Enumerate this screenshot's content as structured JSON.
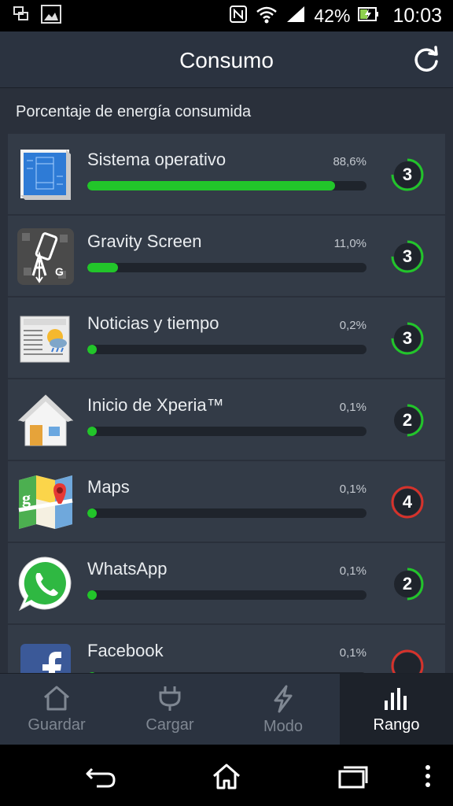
{
  "status_bar": {
    "left_icons": [
      "screenshot-icon",
      "image-icon"
    ],
    "right_icons": [
      "nfc-icon",
      "wifi-icon",
      "signal-icon"
    ],
    "battery_percent": "42%",
    "time": "10:03"
  },
  "app_bar": {
    "title": "Consumo",
    "refresh_icon": "refresh-icon"
  },
  "section_title": "Porcentaje de energía consumida",
  "apps": [
    {
      "name": "Sistema operativo",
      "percent_label": "88,6%",
      "percent": 88.6,
      "rank": "3",
      "rank_level": 0.75,
      "rank_color": "#22c52a",
      "icon": "system-blueprint-icon"
    },
    {
      "name": "Gravity Screen",
      "percent_label": "11,0%",
      "percent": 11.0,
      "rank": "3",
      "rank_level": 0.75,
      "rank_color": "#22c52a",
      "icon": "gravity-screen-icon"
    },
    {
      "name": "Noticias y tiempo",
      "percent_label": "0,2%",
      "percent": 0.2,
      "rank": "3",
      "rank_level": 0.75,
      "rank_color": "#22c52a",
      "icon": "newspaper-icon"
    },
    {
      "name": "Inicio de Xperia™",
      "percent_label": "0,1%",
      "percent": 0.1,
      "rank": "2",
      "rank_level": 0.5,
      "rank_color": "#22c52a",
      "icon": "home-house-icon"
    },
    {
      "name": "Maps",
      "percent_label": "0,1%",
      "percent": 0.1,
      "rank": "4",
      "rank_level": 1.0,
      "rank_color": "#d6322b",
      "icon": "maps-icon"
    },
    {
      "name": "WhatsApp",
      "percent_label": "0,1%",
      "percent": 0.1,
      "rank": "2",
      "rank_level": 0.5,
      "rank_color": "#22c52a",
      "icon": "whatsapp-icon"
    },
    {
      "name": "Facebook",
      "percent_label": "0,1%",
      "percent": 0.1,
      "rank": "",
      "rank_level": 1.0,
      "rank_color": "#d6322b",
      "icon": "facebook-icon"
    }
  ],
  "tabs": [
    {
      "label": "Guardar",
      "icon": "house-icon",
      "active": false
    },
    {
      "label": "Cargar",
      "icon": "plug-icon",
      "active": false
    },
    {
      "label": "Modo",
      "icon": "bolt-icon",
      "active": false
    },
    {
      "label": "Rango",
      "icon": "bar-chart-icon",
      "active": true
    }
  ],
  "nav_bar": {
    "back_icon": "back-icon",
    "home_icon": "home-icon",
    "recents_icon": "recents-icon",
    "menu_icon": "overflow-menu-icon"
  },
  "colors": {
    "accent_green": "#22c52a",
    "warn_red": "#d6322b",
    "header_bg": "#2b3340",
    "row_bg": "#333b47"
  }
}
